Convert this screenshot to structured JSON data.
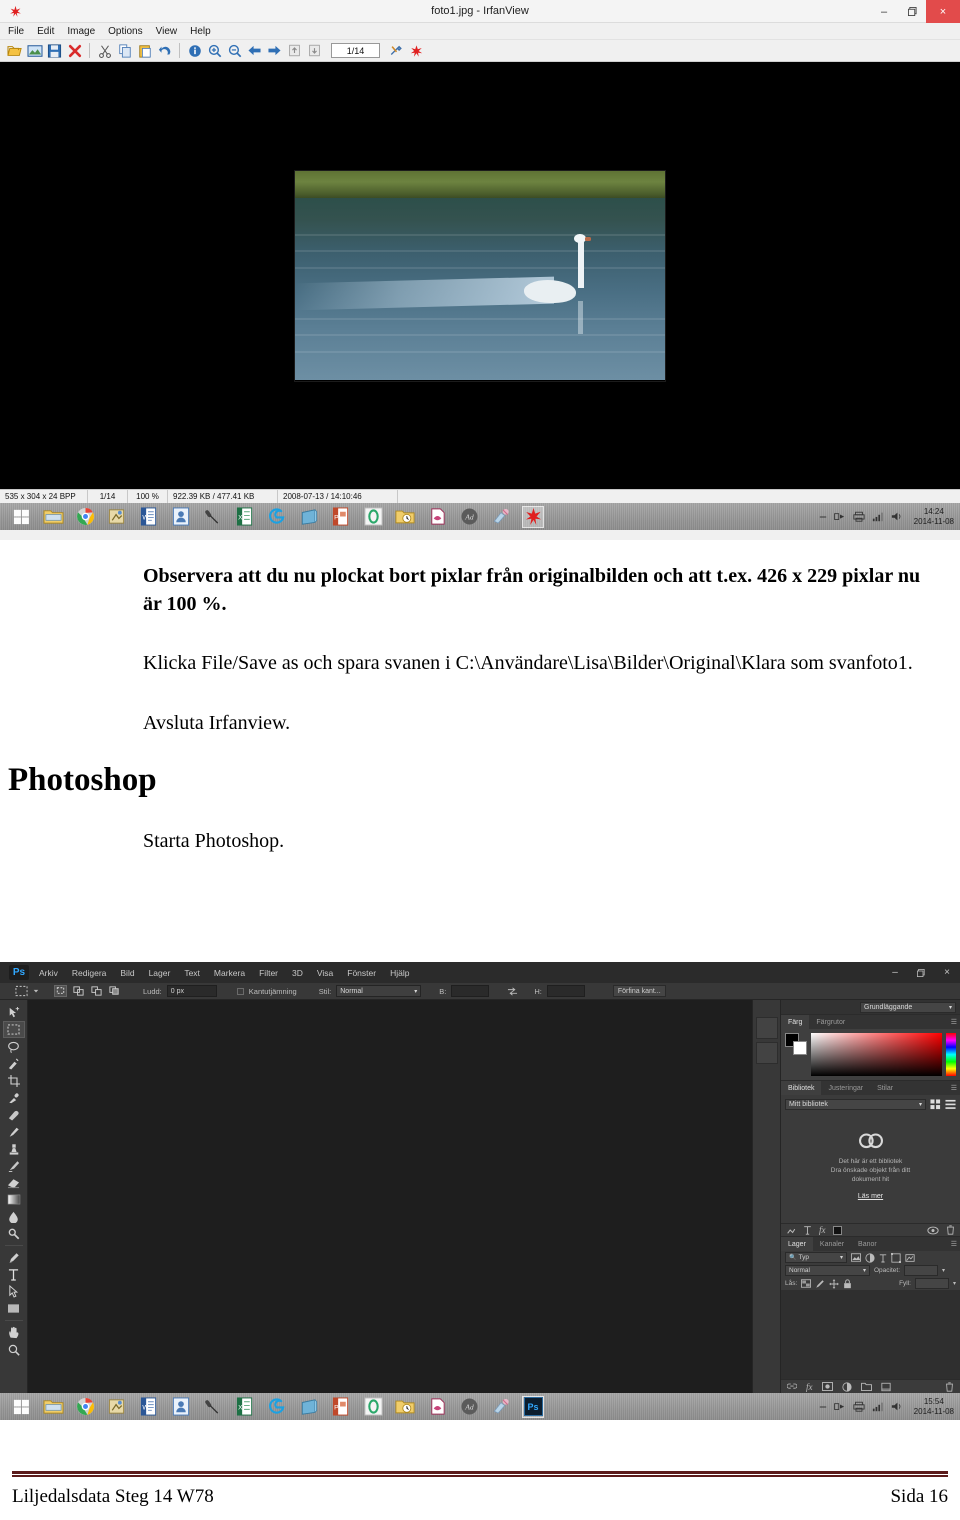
{
  "irfanview": {
    "title": "foto1.jpg - IrfanView",
    "app_icon": "irfanview-icon",
    "window_buttons": {
      "minimize": "–",
      "maximize": "❐",
      "close": "×"
    },
    "menu": [
      "File",
      "Edit",
      "Image",
      "Options",
      "View",
      "Help"
    ],
    "toolbar_icons": [
      "open-folder-icon",
      "thumbnails-icon",
      "save-icon",
      "delete-icon",
      "cut-icon",
      "copy-icon",
      "paste-icon",
      "undo-icon",
      "info-icon",
      "zoom-in-icon",
      "zoom-out-icon",
      "previous-icon",
      "next-icon",
      "first-icon",
      "last-icon"
    ],
    "page_counter": "1/14",
    "toolbar_icons_end": [
      "settings-icon",
      "effects-icon"
    ],
    "statusbar": {
      "dimensions": "535 x 304 x 24 BPP",
      "index": "1/14",
      "zoom": "100 %",
      "size": "922.39 KB / 477.41 KB",
      "date": "2008-07-13 / 14:10:46"
    },
    "image_alt": "swan swimming on lake"
  },
  "taskbar_top": {
    "icons": [
      "windows-start-icon",
      "file-explorer-icon",
      "chrome-icon",
      "paint-shop-icon",
      "word-icon",
      "outlook-contacts-icon",
      "microphone-icon",
      "excel-icon",
      "internet-explorer-icon",
      "onenote-icon",
      "powerpoint-icon",
      "opera-icon",
      "folder-clock-icon",
      "pdf-icon",
      "acrobat-icon",
      "painter-icon"
    ],
    "active_icon": "irfanview-icon",
    "tray_icons": [
      "expand-tray-icon",
      "network-share-icon",
      "printer-icon",
      "signal-icon",
      "volume-icon"
    ],
    "clock_time": "14:24",
    "clock_date": "2014-11-08"
  },
  "document": {
    "para_bold": "Observera att du nu plockat bort pixlar från originalbilden och att t.ex. 426 x 229  pixlar nu är 100 %.",
    "para_save": "Klicka File/Save as och spara svanen i C:\\Användare\\Lisa\\Bilder\\Original\\Klara som svanfoto1.",
    "para_exit": "Avsluta Irfanview.",
    "heading": "Photoshop",
    "para_start": "Starta Photoshop."
  },
  "photoshop": {
    "logo": "Ps",
    "menu": [
      "Arkiv",
      "Redigera",
      "Bild",
      "Lager",
      "Text",
      "Markera",
      "Filter",
      "3D",
      "Visa",
      "Fönster",
      "Hjälp"
    ],
    "window_buttons": {
      "minimize": "–",
      "maximize": "❐",
      "close": "×"
    },
    "options_bar": {
      "tool_icon": "rectangular-marquee-icon",
      "mode_icons": [
        "new-selection-icon",
        "add-selection-icon",
        "subtract-selection-icon",
        "intersect-selection-icon"
      ],
      "feather_label": "Ludd:",
      "feather_value": "0 px",
      "antialias_label": "Kantutjämning",
      "style_label": "Stil:",
      "style_value": "Normal",
      "width_label": "B:",
      "width_value": "",
      "swap_icon": "swap-dimensions-icon",
      "height_label": "H:",
      "height_value": "",
      "refine_edge": "Förfina kant..."
    },
    "toolbox": [
      "move-tool-icon",
      "rectangular-marquee-tool-icon",
      "lasso-tool-icon",
      "quick-selection-tool-icon",
      "crop-tool-icon",
      "eyedropper-tool-icon",
      "spot-healing-tool-icon",
      "brush-tool-icon",
      "clone-stamp-tool-icon",
      "history-brush-tool-icon",
      "eraser-tool-icon",
      "gradient-tool-icon",
      "blur-tool-icon",
      "dodge-tool-icon",
      "pen-tool-icon",
      "type-tool-icon",
      "path-selection-tool-icon",
      "rectangle-tool-icon",
      "hand-tool-icon",
      "zoom-tool-icon"
    ],
    "workspace_select": "Grundläggande",
    "color_panel": {
      "tabs": [
        "Färg",
        "Färgrutor"
      ],
      "active_tab": "Färg",
      "foreground_color": "#000000",
      "background_color": "#ffffff"
    },
    "library_panel": {
      "tabs": [
        "Bibliotek",
        "Justeringar",
        "Stilar"
      ],
      "active_tab": "Bibliotek",
      "selector": "Mitt bibliotek",
      "empty_line1": "Det här är ett bibliotek",
      "empty_line2": "Dra önskade objekt från ditt",
      "empty_line3": "dokument hit",
      "link": "Läs mer",
      "cc_icon": "creative-cloud-icon",
      "view_icons": [
        "grid-view-icon",
        "list-view-icon"
      ]
    },
    "layers_panel": {
      "top_icons": [
        "link-layers-icon",
        "text-layer-icon",
        "layer-style-icon",
        "layer-mask-icon",
        "visibility-icon",
        "delete-layer-icon"
      ],
      "tabs": [
        "Lager",
        "Kanaler",
        "Banor"
      ],
      "active_tab": "Lager",
      "filter_label": "Typ",
      "filter_icons": [
        "pixel-filter-icon",
        "adjustment-filter-icon",
        "type-filter-icon",
        "shape-filter-icon",
        "smart-object-filter-icon"
      ],
      "blend_mode": "Normal",
      "opacity_label": "Opacitet:",
      "opacity_value": "",
      "lock_label": "Lås:",
      "lock_icons": [
        "lock-transparency-icon",
        "lock-image-icon",
        "lock-position-icon",
        "lock-all-icon"
      ],
      "fill_label": "Fyll:",
      "fill_value": "",
      "footer_icons": [
        "link-icon",
        "fx-icon",
        "mask-icon",
        "adjustment-icon",
        "group-icon",
        "new-layer-icon",
        "trash-icon"
      ]
    }
  },
  "taskbar_bottom": {
    "icons": [
      "windows-start-icon",
      "file-explorer-icon",
      "chrome-icon",
      "paint-shop-icon",
      "word-icon",
      "outlook-contacts-icon",
      "microphone-icon",
      "excel-icon",
      "internet-explorer-icon",
      "onenote-icon",
      "powerpoint-icon",
      "opera-icon",
      "folder-clock-icon",
      "pdf-icon",
      "acrobat-icon",
      "painter-icon"
    ],
    "active_icon": "photoshop-icon",
    "active_label": "Ps",
    "tray_icons": [
      "expand-tray-icon",
      "network-share-icon",
      "printer-icon",
      "signal-icon",
      "volume-icon"
    ],
    "clock_time": "15:54",
    "clock_date": "2014-11-08"
  },
  "footer": {
    "left": "Liljedalsdata Steg 14 W78",
    "right": "Sida 16",
    "rule_color": "#5b1a1a"
  }
}
